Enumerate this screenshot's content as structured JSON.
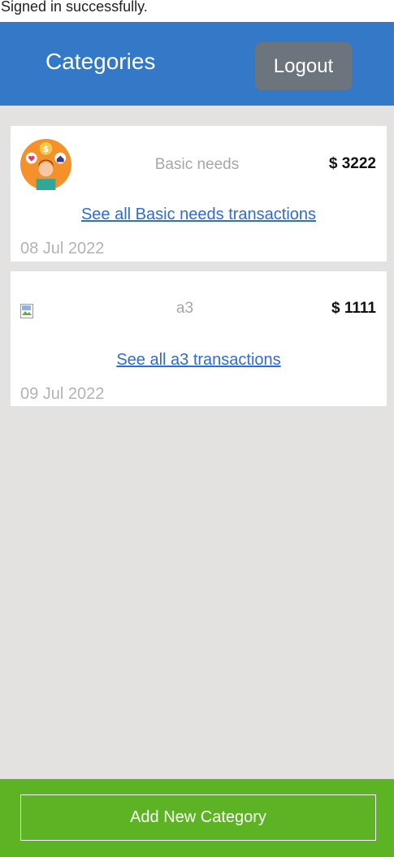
{
  "flash": {
    "message": "Signed in successfully."
  },
  "header": {
    "title": "Categories",
    "logout_label": "Logout"
  },
  "categories": [
    {
      "name": "Basic needs",
      "amount": "$ 3222",
      "link_label": "See all Basic needs transactions",
      "date": "08 Jul 2022",
      "icon": "person-with-money-heart-house-icon"
    },
    {
      "name": "a3",
      "amount": "$ 1111",
      "link_label": "See all a3 transactions",
      "date": "09 Jul 2022",
      "icon": "broken-image-icon"
    }
  ],
  "footer": {
    "add_label": "Add New Category"
  },
  "colors": {
    "header_bg": "#3478c8",
    "logout_bg": "#6c757d",
    "footer_bg": "#5cb424",
    "link": "#2f6bd4",
    "page_bg": "#e3e2e1"
  }
}
